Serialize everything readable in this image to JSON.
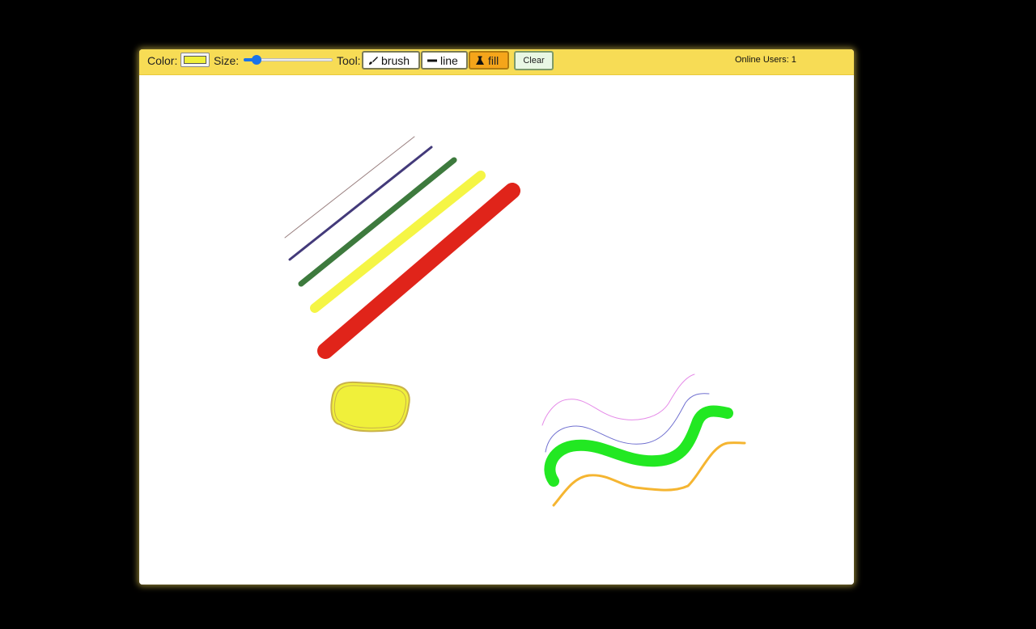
{
  "toolbar": {
    "color_label": "Color:",
    "selected_color": "#f0f03a",
    "size_label": "Size:",
    "size_value_fraction": 0.1,
    "tool_label": "Tool:",
    "tools": [
      {
        "label": "brush",
        "icon": "brush-icon",
        "active": false
      },
      {
        "label": "line",
        "icon": "line-icon",
        "active": false
      },
      {
        "label": "fill",
        "icon": "flask-icon",
        "active": true
      }
    ],
    "clear_label": "Clear",
    "online_users": "Online Users: 1"
  },
  "canvas": {
    "background": "#ffffff",
    "stroke_colors": {
      "thin_brown": "#9a8080",
      "navy": "#433a7a",
      "green": "#3d7a3d",
      "yellow": "#f5f545",
      "red": "#e0241a",
      "fill_yellow": "#f0f03a",
      "fill_outline": "#c9b24a",
      "pink": "#e58ae8",
      "blue": "#7070d0",
      "bright_green": "#22e822",
      "orange": "#f5b531"
    }
  }
}
